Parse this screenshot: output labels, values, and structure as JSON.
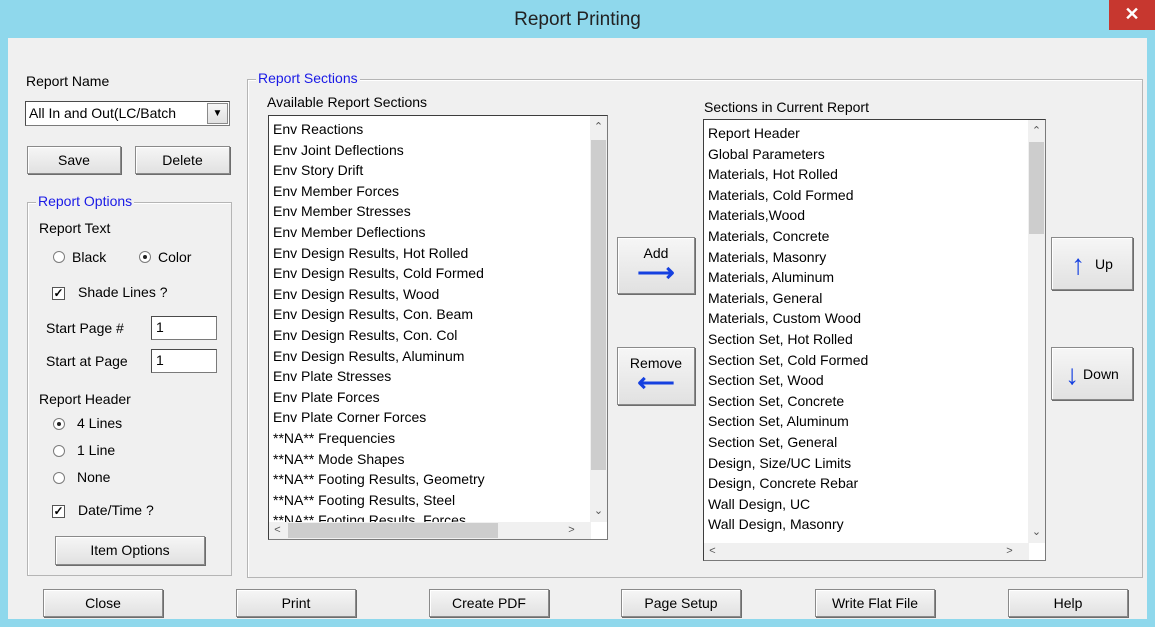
{
  "window": {
    "title": "Report Printing",
    "close_glyph": "✕"
  },
  "report_name": {
    "label": "Report Name",
    "selected": "All In and Out(LC/Batch",
    "save_label": "Save",
    "delete_label": "Delete"
  },
  "report_options": {
    "legend": "Report Options",
    "report_text_label": "Report Text",
    "black_label": "Black",
    "color_label": "Color",
    "text_mode": "Color",
    "shade_lines_label": "Shade Lines ?",
    "shade_lines_checked": true,
    "start_page_num_label": "Start Page #",
    "start_page_num_value": "1",
    "start_at_page_label": "Start at Page",
    "start_at_page_value": "1",
    "report_header_label": "Report Header",
    "four_lines_label": "4 Lines",
    "one_line_label": "1 Line",
    "none_label": "None",
    "header_mode": "4 Lines",
    "date_time_label": "Date/Time ?",
    "date_time_checked": true,
    "item_options_label": "Item Options"
  },
  "report_sections": {
    "legend": "Report Sections",
    "available_label": "Available Report Sections",
    "available": [
      "Env Reactions",
      "Env Joint Deflections",
      "Env Story Drift",
      "Env Member Forces",
      "Env Member Stresses",
      "Env Member Deflections",
      "Env Design Results, Hot Rolled",
      "Env Design Results, Cold Formed",
      "Env Design Results, Wood",
      "Env Design Results, Con. Beam",
      "Env Design Results, Con. Col",
      "Env Design Results, Aluminum",
      "Env Plate Stresses",
      "Env Plate Forces",
      "Env Plate Corner Forces",
      "**NA** Frequencies",
      "**NA** Mode Shapes",
      "**NA** Footing Results, Geometry",
      "**NA** Footing Results, Steel",
      "**NA** Footing Results, Forces"
    ],
    "current_label": "Sections in Current Report",
    "current": [
      "Report Header",
      "Global Parameters",
      "Materials, Hot Rolled",
      "Materials, Cold Formed",
      "Materials,Wood",
      "Materials, Concrete",
      "Materials, Masonry",
      "Materials, Aluminum",
      "Materials, General",
      "Materials, Custom Wood",
      "Section Set, Hot Rolled",
      "Section Set, Cold Formed",
      "Section Set, Wood",
      "Section Set, Concrete",
      "Section Set, Aluminum",
      "Section Set, General",
      "Design, Size/UC Limits",
      "Design, Concrete Rebar",
      "Wall Design, UC",
      "Wall Design, Masonry"
    ],
    "add_label": "Add",
    "remove_label": "Remove",
    "up_label": "Up",
    "down_label": "Down"
  },
  "footer": {
    "close_label": "Close",
    "print_label": "Print",
    "create_pdf_label": "Create PDF",
    "page_setup_label": "Page Setup",
    "write_flat_file_label": "Write Flat File",
    "help_label": "Help"
  },
  "icons": {
    "right_arrow": "⟶",
    "left_arrow": "⟵",
    "up_arrow": "↑",
    "down_arrow": "↓",
    "scroll_up": "▲",
    "scroll_down": "▼",
    "scroll_left": "◀",
    "scroll_right": "▶",
    "combo_down": "▼"
  },
  "colors": {
    "title_bar": "#8fd8ec",
    "close_button": "#c7372f",
    "legend_text": "#1a1ae6",
    "arrow_blue": "#1540e0"
  }
}
